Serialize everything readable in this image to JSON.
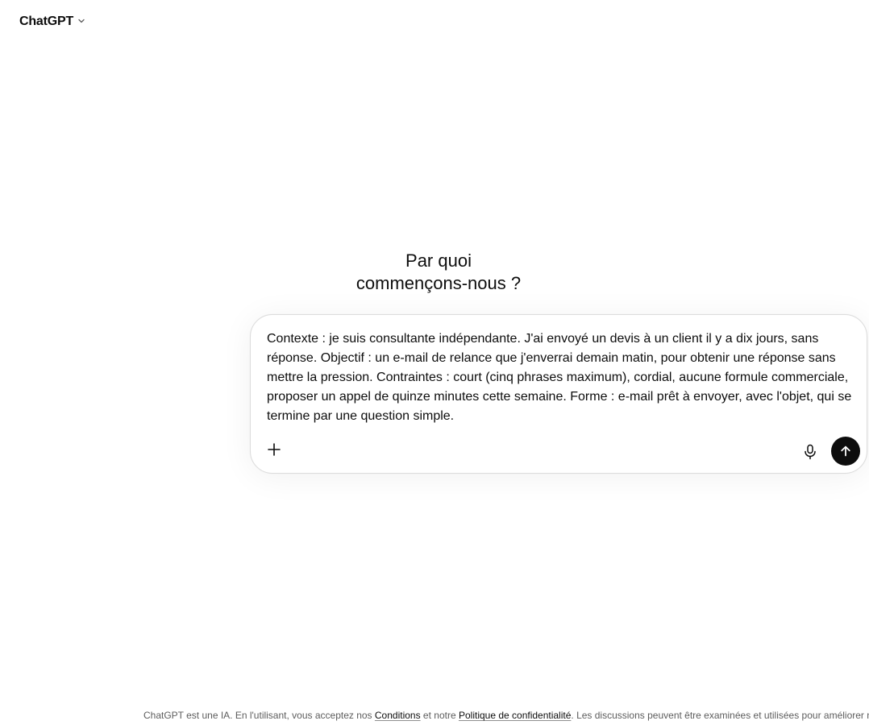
{
  "header": {
    "model_name": "ChatGPT",
    "chevron_icon": "chevron-down-icon"
  },
  "main": {
    "headline_line1": "Par quoi",
    "headline_line2": "commençons-nous ?"
  },
  "composer": {
    "prompt_value": "Contexte : je suis consultante indépendante. J'ai envoyé un devis à un client il y a dix jours, sans réponse. Objectif : un e-mail de relance que j'enverrai demain matin, pour obtenir une réponse sans mettre la pression. Contraintes : court (cinq phrases maximum), cordial, aucune formule commerciale, proposer un appel de quinze minutes cette semaine. Forme : e-mail prêt à envoyer, avec l'objet, qui se termine par une question simple.",
    "plus_icon": "plus-icon",
    "mic_icon": "microphone-icon",
    "send_icon": "arrow-up-icon"
  },
  "footer": {
    "text_before": "ChatGPT est une IA. En l'utilisant, vous acceptez nos ",
    "conditions_link": "Conditions",
    "text_middle": " et notre ",
    "privacy_link": "Politique de confidentialité",
    "text_after": ". Les discussions peuvent être examinées et utilisées pour améliorer nos mo"
  }
}
